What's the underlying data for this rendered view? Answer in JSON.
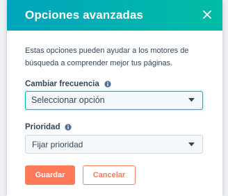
{
  "modal": {
    "title": "Opciones avanzadas",
    "description": "Estas opciones pueden ayudar a los motores de búsqueda a comprender mejor tus páginas."
  },
  "fields": {
    "frequency": {
      "label": "Cambiar frecuencia",
      "value": "Seleccionar opción"
    },
    "priority": {
      "label": "Prioridad",
      "value": "Fijar prioridad"
    }
  },
  "buttons": {
    "save_label": "Guardar",
    "cancel_label": "Cancelar"
  },
  "icons": {
    "close": "close-icon",
    "info": "info-icon",
    "caret": "chevron-down-icon"
  },
  "colors": {
    "header_gradient_start": "#00a4bd",
    "header_gradient_end": "#00bda5",
    "primary_button": "#ff7a59",
    "text": "#33475b",
    "focus_border": "#00bda5"
  }
}
